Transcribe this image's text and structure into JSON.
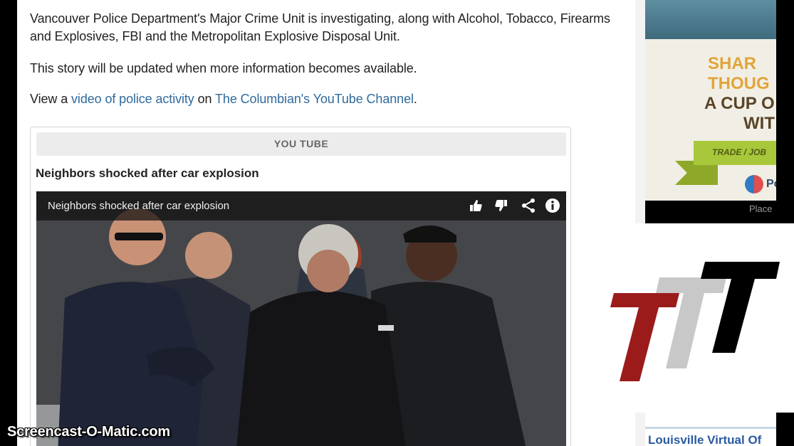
{
  "article": {
    "paragraph1": "Vancouver Police Department's Major Crime Unit is investigating, along with Alcohol, Tobacco, Firearms and Explosives, FBI and the Metropolitan Explosive Disposal Unit.",
    "paragraph2": "This story will be updated when more information becomes available.",
    "paragraph3": {
      "prefix": "View a ",
      "video_link": "video of police activity",
      "middle": " on ",
      "channel_link": "The Columbian's YouTube Channel",
      "suffix": "."
    }
  },
  "youtube_box": {
    "tab_label": "YOU TUBE",
    "heading": "Neighbors shocked after car explosion",
    "video": {
      "title": "Neighbors shocked after car explosion",
      "buttons": [
        "like-icon",
        "dislike-icon",
        "share-icon",
        "info-icon"
      ]
    }
  },
  "sidebar_ad": {
    "lines": [
      "SHAR",
      "THOUG",
      "A CUP O",
      "WIT"
    ],
    "banner": "TRADE / JOB",
    "logo_text": "Po",
    "placement": "Place"
  },
  "sidebar_bottom": {
    "link": "Louisville Virtual Of"
  },
  "watermark": "Screencast-O-Matic.com",
  "colors": {
    "link": "#2f6a9c",
    "ad_orange": "#e2a43a",
    "ad_brown": "#5a4428",
    "ad_green": "#a9c73a",
    "logo_red": "#9b1b1b",
    "logo_gray": "#c8c8c8",
    "logo_black": "#000000"
  }
}
